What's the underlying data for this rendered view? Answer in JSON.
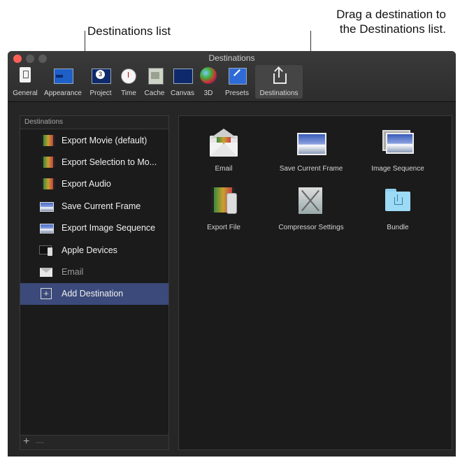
{
  "callouts": {
    "left": "Destinations list",
    "right_line1": "Drag a destination to",
    "right_line2": "the Destinations list."
  },
  "window": {
    "title": "Destinations",
    "traffic_colors": [
      "#ff5f57",
      "#5a5a5a",
      "#5a5a5a"
    ]
  },
  "toolbar": {
    "tabs": [
      {
        "label": "General",
        "icon": "switch-icon"
      },
      {
        "label": "Appearance",
        "icon": "window-icon"
      },
      {
        "label": "Project",
        "icon": "project-icon"
      },
      {
        "label": "Time",
        "icon": "stopwatch-icon"
      },
      {
        "label": "Cache",
        "icon": "cache-icon"
      },
      {
        "label": "Canvas",
        "icon": "canvas-icon"
      },
      {
        "label": "3D",
        "icon": "sphere-icon"
      },
      {
        "label": "Presets",
        "icon": "presets-icon"
      },
      {
        "label": "Destinations",
        "icon": "share-icon"
      }
    ],
    "active_tab": "Destinations"
  },
  "sidebar": {
    "header": "Destinations",
    "items": [
      {
        "label": "Export Movie (default)",
        "icon": "film-icon"
      },
      {
        "label": "Export Selection to Mo...",
        "icon": "film-icon"
      },
      {
        "label": "Export Audio",
        "icon": "film-icon"
      },
      {
        "label": "Save Current Frame",
        "icon": "photo-icon"
      },
      {
        "label": "Export Image Sequence",
        "icon": "photo-icon"
      },
      {
        "label": "Apple Devices",
        "icon": "devices-icon"
      },
      {
        "label": "Email",
        "icon": "envelope-icon"
      },
      {
        "label": "Add Destination",
        "icon": "plus-box-icon"
      }
    ],
    "footer": {
      "add": "+",
      "remove": "—"
    }
  },
  "destinations_panel": {
    "tiles": [
      {
        "label": "Email",
        "icon": "envelope-icon"
      },
      {
        "label": "Save Current Frame",
        "icon": "photo-icon"
      },
      {
        "label": "Image Sequence",
        "icon": "photo-stack-icon"
      },
      {
        "label": "Export File",
        "icon": "film-phone-icon"
      },
      {
        "label": "Compressor Settings",
        "icon": "compressor-icon"
      },
      {
        "label": "Bundle",
        "icon": "folder-share-icon"
      }
    ]
  },
  "colors": {
    "selection": "#3b4a7a",
    "window_bg": "#262626",
    "accent_blue": "#2f6bd6"
  }
}
